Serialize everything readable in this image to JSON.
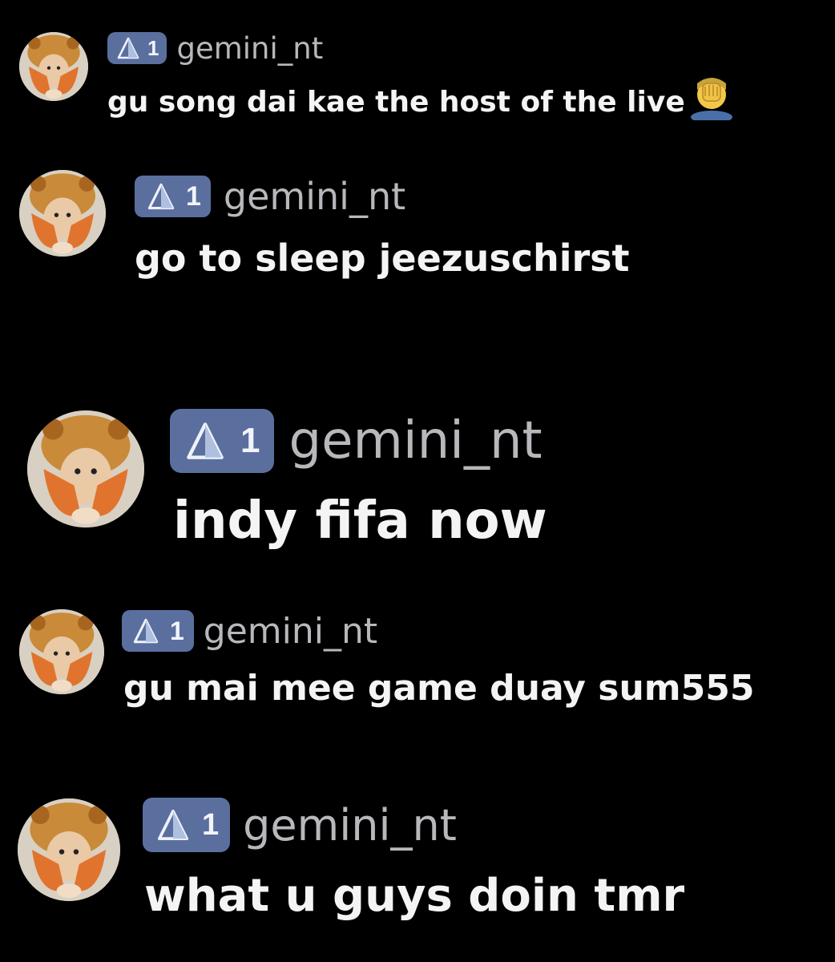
{
  "icons": {
    "avatar": "user-avatar-photo",
    "badge": "level-triangle-icon",
    "emoji": "face-palm-emoji"
  },
  "colors": {
    "background": "#000000",
    "badge": "#5b6f9e",
    "username": "#b8b8bc",
    "message": "#f4f4f4"
  },
  "comments": [
    {
      "level": "1",
      "username": "gemini_nt",
      "message": "gu song dai kae the host of the live"
    },
    {
      "level": "1",
      "username": "gemini_nt",
      "message": "go to sleep jeezuschirst"
    },
    {
      "level": "1",
      "username": "gemini_nt",
      "message": "indy fifa now"
    },
    {
      "level": "1",
      "username": "gemini_nt",
      "message": "gu mai mee game duay sum555"
    },
    {
      "level": "1",
      "username": "gemini_nt",
      "message": "what u guys doin tmr"
    }
  ]
}
